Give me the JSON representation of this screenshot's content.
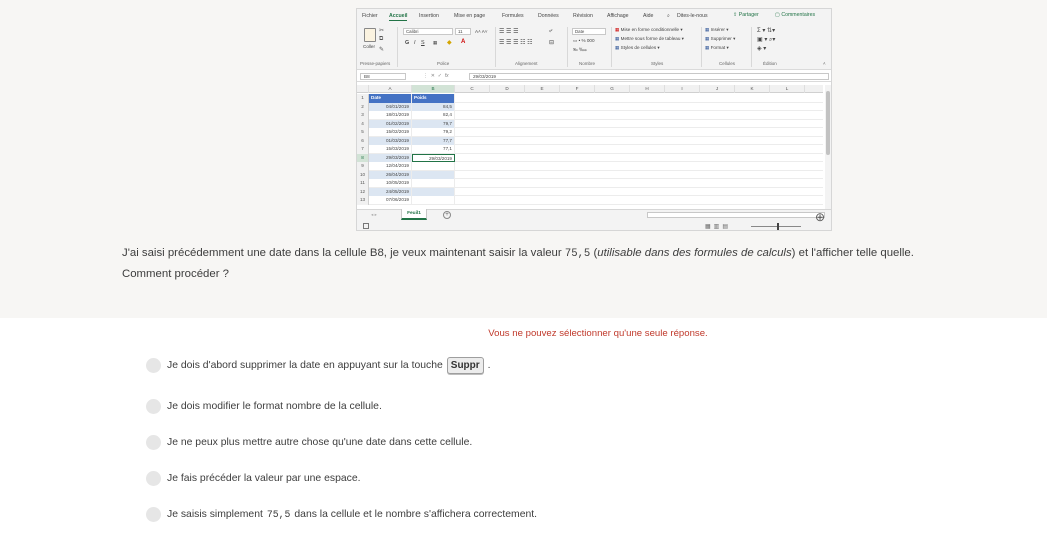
{
  "excel": {
    "menu": [
      "Fichier",
      "Accueil",
      "Insertion",
      "Mise en page",
      "Formules",
      "Données",
      "Révision",
      "Affichage",
      "Aide",
      "Dites-le-nous"
    ],
    "active_tab": "Accueil",
    "share": "Partager",
    "comments": "Commentaires",
    "ribbon": {
      "paste": "Coller",
      "font_name": "Calibri",
      "font_size": "11",
      "number_format": "Date",
      "cond_format": "Mise en forme conditionnelle",
      "table_format": "Mettre sous forme de tableau",
      "cell_styles": "Styles de cellules",
      "insert": "Insérer",
      "delete": "Supprimer",
      "format": "Format",
      "groups": [
        "Presse-papiers",
        "Police",
        "Alignement",
        "Nombre",
        "Styles",
        "Cellules",
        "Édition"
      ]
    },
    "name_box": "B8",
    "formula_value": "29/03/2019",
    "columns": [
      "A",
      "B",
      "C",
      "D",
      "E",
      "F",
      "G",
      "H",
      "I",
      "J",
      "K",
      "L"
    ],
    "header_row": {
      "num": "1",
      "a": "Date",
      "b": "Poids"
    },
    "rows": [
      {
        "num": "2",
        "a": "04/01/2019",
        "b": "84,5"
      },
      {
        "num": "3",
        "a": "18/01/2019",
        "b": "82,4"
      },
      {
        "num": "4",
        "a": "01/02/2019",
        "b": "79,7"
      },
      {
        "num": "5",
        "a": "15/02/2019",
        "b": "79,2"
      },
      {
        "num": "6",
        "a": "01/03/2019",
        "b": "77,7"
      },
      {
        "num": "7",
        "a": "15/03/2019",
        "b": "77,1"
      },
      {
        "num": "8",
        "a": "29/03/2019",
        "b": "29/03/2019"
      },
      {
        "num": "9",
        "a": "12/04/2019",
        "b": ""
      },
      {
        "num": "10",
        "a": "26/04/2019",
        "b": ""
      },
      {
        "num": "11",
        "a": "10/05/2019",
        "b": ""
      },
      {
        "num": "12",
        "a": "24/05/2019",
        "b": ""
      },
      {
        "num": "13",
        "a": "07/06/2019",
        "b": ""
      }
    ],
    "sheet_tab": "Feuil1"
  },
  "question": {
    "part1": "J'ai saisi précédemment une date dans la cellule B8, je veux maintenant saisir la valeur ",
    "value": "75,5",
    "part2": " (",
    "italic": "utilisable dans des formules de calculs",
    "part3": ") et l'afficher telle quelle.",
    "line2": "Comment procéder ?"
  },
  "instruction": "Vous ne pouvez sélectionner qu'une seule réponse.",
  "options": [
    {
      "text": "Je dois d'abord supprimer la date en appuyant sur la touche",
      "key": "Suppr",
      "after": "."
    },
    {
      "text": "Je dois modifier le format nombre de la cellule."
    },
    {
      "text": "Je ne peux plus mettre autre chose qu'une date dans cette cellule."
    },
    {
      "text": "Je fais précéder la valeur par une espace."
    },
    {
      "before": "Je saisis simplement",
      "value": "75,5",
      "after": "dans la cellule et le nombre s'affichera correctement."
    }
  ]
}
